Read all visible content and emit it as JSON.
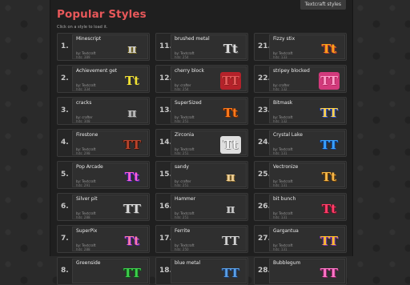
{
  "page": {
    "tag": "Textcraft styles",
    "title": "Popular Styles",
    "subtitle": "Click on a style to load it."
  },
  "cards": [
    {
      "num": "1.",
      "name": "Minescript",
      "by": "by: Textcraft",
      "hits": "hits: 389",
      "glyph": "π",
      "color": "#d2d2d2",
      "shadow": "#7b6a20",
      "bg": "transparent"
    },
    {
      "num": "11.",
      "name": "brushed metal",
      "by": "by: Textcraft",
      "hits": "hits: 254",
      "glyph": "Tt",
      "color": "#dcdcdc",
      "shadow": "#555555",
      "bg": "transparent"
    },
    {
      "num": "21.",
      "name": "Fizzy stix",
      "by": "by: Textcraft",
      "hits": "hits: 133",
      "glyph": "Tt",
      "color": "#f7a11a",
      "shadow": "#c0392b",
      "bg": "transparent"
    },
    {
      "num": "2.",
      "name": "Achievement get",
      "by": "by: Textcraft",
      "hits": "hits: 334",
      "glyph": "Tt",
      "color": "#f2e233",
      "shadow": "#333",
      "bg": "transparent"
    },
    {
      "num": "12.",
      "name": "cherry block",
      "by": "by: crafter",
      "hits": "hits: 254",
      "glyph": "TT",
      "color": "#e35a5a",
      "shadow": "#8f1d1d",
      "bg": "#b4222a"
    },
    {
      "num": "22.",
      "name": "stripey blocked",
      "by": "by: crafter",
      "hits": "hits: 132",
      "glyph": "TT",
      "color": "#ff9ecb",
      "shadow": "#b3275f",
      "bg": "#d23a7c"
    },
    {
      "num": "3.",
      "name": "cracks",
      "by": "by: crafter",
      "hits": "hits: 308",
      "glyph": "π",
      "color": "#bdbdbd",
      "shadow": "#5a5a5a",
      "bg": "transparent"
    },
    {
      "num": "13.",
      "name": "SuperSized",
      "by": "by: Textcraft",
      "hits": "hits: 251",
      "glyph": "Tt",
      "color": "#ff7b1c",
      "shadow": "#7a2b00",
      "bg": "transparent"
    },
    {
      "num": "23.",
      "name": "Bitmask",
      "by": "by: Textcraft",
      "hits": "hits: 132",
      "glyph": "TT",
      "color": "#ffd34a",
      "shadow": "#2445c8",
      "bg": "transparent"
    },
    {
      "num": "4.",
      "name": "Firestone",
      "by": "by: Textcraft",
      "hits": "hits: 298",
      "glyph": "TT",
      "color": "#b9442c",
      "shadow": "#3a120a",
      "bg": "transparent"
    },
    {
      "num": "14.",
      "name": "Zirconia",
      "by": "by: Textcraft",
      "hits": "hits: 251",
      "glyph": "Tt",
      "color": "#f2f2f2",
      "shadow": "#8a8a8a",
      "bg": "#dedede"
    },
    {
      "num": "24.",
      "name": "Crystal Lake",
      "by": "by: Textcraft",
      "hits": "hits: 131",
      "glyph": "TT",
      "color": "#3aa2ff",
      "shadow": "#0d3c8c",
      "bg": "transparent"
    },
    {
      "num": "5.",
      "name": "Pop Arcade",
      "by": "by: Textcraft",
      "hits": "hits: 291",
      "glyph": "Tt",
      "color": "#ff5fd0",
      "shadow": "#3b1fb0",
      "bg": "transparent"
    },
    {
      "num": "15.",
      "name": "sandy",
      "by": "by: crafter",
      "hits": "hits: 251",
      "glyph": "π",
      "color": "#f0d29a",
      "shadow": "#8c6a2a",
      "bg": "transparent"
    },
    {
      "num": "25.",
      "name": "Vectronize",
      "by": "by: Textcraft",
      "hits": "hits: 131",
      "glyph": "Tt",
      "color": "#f5b84a",
      "shadow": "#6d3c00",
      "bg": "transparent"
    },
    {
      "num": "6.",
      "name": "Silver pit",
      "by": "by: Textcraft",
      "hits": "hits: 288",
      "glyph": "TT",
      "color": "#d9d9d9",
      "shadow": "#555",
      "bg": "transparent"
    },
    {
      "num": "16.",
      "name": "Hammer",
      "by": "by: Textcraft",
      "hits": "hits: 251",
      "glyph": "π",
      "color": "#c9c9c9",
      "shadow": "#444",
      "bg": "transparent"
    },
    {
      "num": "26.",
      "name": "bit bunch",
      "by": "by: Textcraft",
      "hits": "hits: 131",
      "glyph": "Tt",
      "color": "#ff3f6a",
      "shadow": "#7a0d26",
      "bg": "transparent"
    },
    {
      "num": "7.",
      "name": "SuperPix",
      "by": "by: Textcraft",
      "hits": "hits: 288",
      "glyph": "Tt",
      "color": "#ff7aa8",
      "shadow": "#5a1fb3",
      "bg": "transparent"
    },
    {
      "num": "17.",
      "name": "Ferrite",
      "by": "by: Textcraft",
      "hits": "hits: 250",
      "glyph": "TT",
      "color": "#d0d0d0",
      "shadow": "#333",
      "bg": "transparent"
    },
    {
      "num": "27.",
      "name": "Gargantua",
      "by": "by: Textcraft",
      "hits": "hits: 131",
      "glyph": "TT",
      "color": "#ffbf2a",
      "shadow": "#7a2fb3",
      "bg": "transparent"
    },
    {
      "num": "8.",
      "name": "Greenside",
      "by": "",
      "hits": "",
      "glyph": "TT",
      "color": "#3ecf4d",
      "shadow": "#0d5a16",
      "bg": "transparent"
    },
    {
      "num": "18.",
      "name": "blue metal",
      "by": "",
      "hits": "",
      "glyph": "TT",
      "color": "#5aa0e6",
      "shadow": "#1b3d73",
      "bg": "transparent"
    },
    {
      "num": "28.",
      "name": "Bubblegum",
      "by": "",
      "hits": "",
      "glyph": "TT",
      "color": "#ff78c8",
      "shadow": "#8c1f63",
      "bg": "transparent"
    }
  ]
}
